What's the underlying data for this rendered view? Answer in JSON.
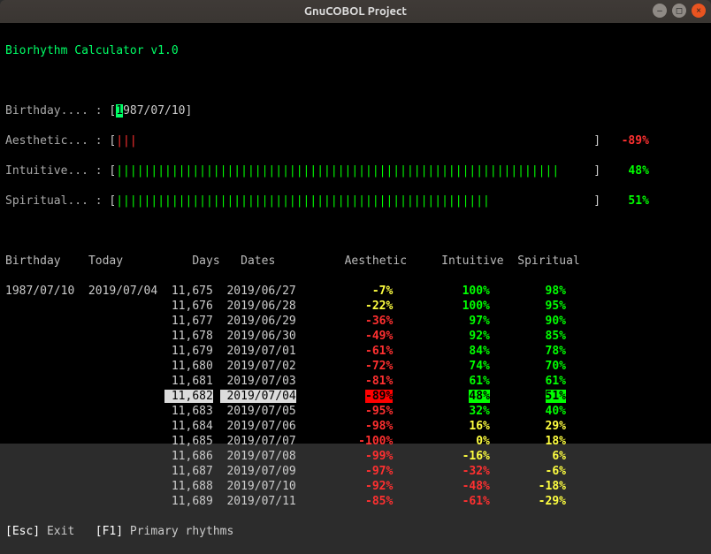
{
  "window": {
    "title": "GnuCOBOL Project"
  },
  "app": {
    "title": "Biorhythm Calculator v1.0"
  },
  "labels": {
    "birthday": "Birthday.... :",
    "aesthetic": "Aesthetic... :",
    "intuitive": "Intuitive... :",
    "spiritual": "Spiritual... :"
  },
  "input": {
    "cursor_char": "1",
    "rest": "987/07/10"
  },
  "bars": {
    "aesthetic": {
      "ticks": 3,
      "color": "red",
      "pct": "-89%"
    },
    "intuitive": {
      "ticks": 64,
      "color": "green",
      "pct": "48%"
    },
    "spiritual": {
      "ticks": 54,
      "color": "green",
      "pct": "51%"
    }
  },
  "table": {
    "headers": {
      "birthday": "Birthday",
      "today": "Today",
      "days": "Days",
      "dates": "Dates",
      "aesthetic": "Aesthetic",
      "intuitive": "Intuitive",
      "spiritual": "Spiritual"
    },
    "birthday": "1987/07/10",
    "today": "2019/07/04",
    "rows": [
      {
        "days": "11,675",
        "date": "2019/06/27",
        "aes": "-7%",
        "aes_c": "yellow",
        "int": "100%",
        "int_c": "green",
        "spi": "98%",
        "spi_c": "green"
      },
      {
        "days": "11,676",
        "date": "2019/06/28",
        "aes": "-22%",
        "aes_c": "yellow",
        "int": "100%",
        "int_c": "green",
        "spi": "95%",
        "spi_c": "green"
      },
      {
        "days": "11,677",
        "date": "2019/06/29",
        "aes": "-36%",
        "aes_c": "red",
        "int": "97%",
        "int_c": "green",
        "spi": "90%",
        "spi_c": "green"
      },
      {
        "days": "11,678",
        "date": "2019/06/30",
        "aes": "-49%",
        "aes_c": "red",
        "int": "92%",
        "int_c": "green",
        "spi": "85%",
        "spi_c": "green"
      },
      {
        "days": "11,679",
        "date": "2019/07/01",
        "aes": "-61%",
        "aes_c": "red",
        "int": "84%",
        "int_c": "green",
        "spi": "78%",
        "spi_c": "green"
      },
      {
        "days": "11,680",
        "date": "2019/07/02",
        "aes": "-72%",
        "aes_c": "red",
        "int": "74%",
        "int_c": "green",
        "spi": "70%",
        "spi_c": "green"
      },
      {
        "days": "11,681",
        "date": "2019/07/03",
        "aes": "-81%",
        "aes_c": "red",
        "int": "61%",
        "int_c": "green",
        "spi": "61%",
        "spi_c": "green"
      },
      {
        "days": "11,682",
        "date": "2019/07/04",
        "aes": "-89%",
        "aes_c": "red",
        "int": "48%",
        "int_c": "green",
        "spi": "51%",
        "spi_c": "green",
        "today": true
      },
      {
        "days": "11,683",
        "date": "2019/07/05",
        "aes": "-95%",
        "aes_c": "red",
        "int": "32%",
        "int_c": "green",
        "spi": "40%",
        "spi_c": "green"
      },
      {
        "days": "11,684",
        "date": "2019/07/06",
        "aes": "-98%",
        "aes_c": "red",
        "int": "16%",
        "int_c": "yellow",
        "spi": "29%",
        "spi_c": "yellow"
      },
      {
        "days": "11,685",
        "date": "2019/07/07",
        "aes": "-100%",
        "aes_c": "red",
        "int": "0%",
        "int_c": "yellow",
        "spi": "18%",
        "spi_c": "yellow"
      },
      {
        "days": "11,686",
        "date": "2019/07/08",
        "aes": "-99%",
        "aes_c": "red",
        "int": "-16%",
        "int_c": "yellow",
        "spi": "6%",
        "spi_c": "yellow"
      },
      {
        "days": "11,687",
        "date": "2019/07/09",
        "aes": "-97%",
        "aes_c": "red",
        "int": "-32%",
        "int_c": "red",
        "spi": "-6%",
        "spi_c": "yellow"
      },
      {
        "days": "11,688",
        "date": "2019/07/10",
        "aes": "-92%",
        "aes_c": "red",
        "int": "-48%",
        "int_c": "red",
        "spi": "-18%",
        "spi_c": "yellow"
      },
      {
        "days": "11,689",
        "date": "2019/07/11",
        "aes": "-85%",
        "aes_c": "red",
        "int": "-61%",
        "int_c": "red",
        "spi": "-29%",
        "spi_c": "yellow"
      }
    ]
  },
  "footer": {
    "esc_key": "[Esc]",
    "esc_label": "Exit",
    "f1_key": "[F1]",
    "f1_label": "Primary rhythms"
  },
  "chart_data": {
    "type": "table",
    "title": "Biorhythm percentages by day",
    "x": [
      "2019/06/27",
      "2019/06/28",
      "2019/06/29",
      "2019/06/30",
      "2019/07/01",
      "2019/07/02",
      "2019/07/03",
      "2019/07/04",
      "2019/07/05",
      "2019/07/06",
      "2019/07/07",
      "2019/07/08",
      "2019/07/09",
      "2019/07/10",
      "2019/07/11"
    ],
    "series": [
      {
        "name": "Aesthetic",
        "values": [
          -7,
          -22,
          -36,
          -49,
          -61,
          -72,
          -81,
          -89,
          -95,
          -98,
          -100,
          -99,
          -97,
          -92,
          -85
        ]
      },
      {
        "name": "Intuitive",
        "values": [
          100,
          100,
          97,
          92,
          84,
          74,
          61,
          48,
          32,
          16,
          0,
          -16,
          -32,
          -48,
          -61
        ]
      },
      {
        "name": "Spiritual",
        "values": [
          98,
          95,
          90,
          85,
          78,
          70,
          61,
          51,
          40,
          29,
          18,
          6,
          -6,
          -18,
          -29
        ]
      }
    ],
    "ylim": [
      -100,
      100
    ]
  }
}
